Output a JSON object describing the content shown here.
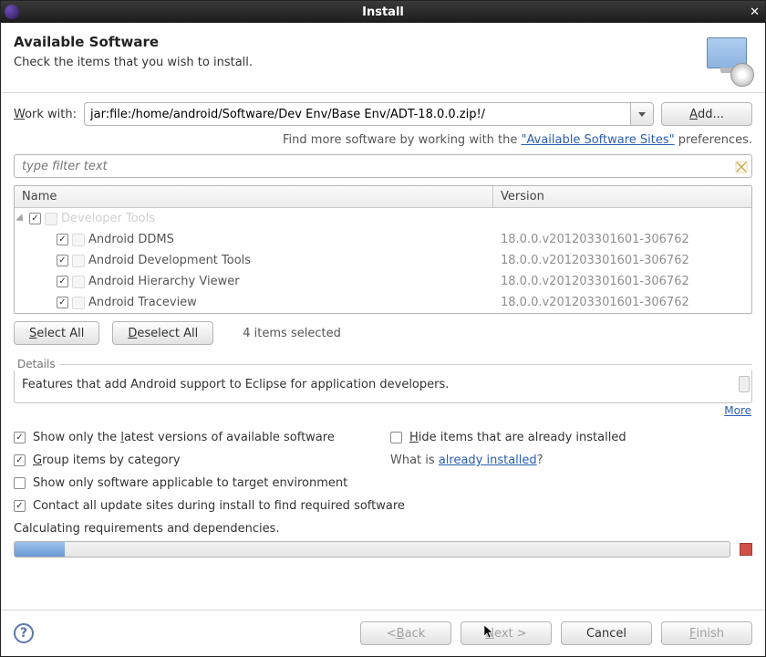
{
  "window": {
    "title": "Install"
  },
  "header": {
    "title": "Available Software",
    "subtitle": "Check the items that you wish to install."
  },
  "workwith": {
    "label_pre": "W",
    "label_post": "ork with:",
    "value": "jar:file:/home/android/Software/Dev Env/Base Env/ADT-18.0.0.zip!/",
    "add_pre": "A",
    "add_post": "dd..."
  },
  "findmore": {
    "prefix": "Find more software by working with the ",
    "link": "\"Available Software Sites\"",
    "suffix": " preferences."
  },
  "filter": {
    "placeholder": "type filter text"
  },
  "columns": {
    "name": "Name",
    "version": "Version"
  },
  "group": {
    "label": "Developer Tools",
    "checked": true
  },
  "items": [
    {
      "name": "Android DDMS",
      "version": "18.0.0.v201203301601-306762",
      "checked": true
    },
    {
      "name": "Android Development Tools",
      "version": "18.0.0.v201203301601-306762",
      "checked": true
    },
    {
      "name": "Android Hierarchy Viewer",
      "version": "18.0.0.v201203301601-306762",
      "checked": true
    },
    {
      "name": "Android Traceview",
      "version": "18.0.0.v201203301601-306762",
      "checked": true
    }
  ],
  "selection": {
    "select_all_pre": "S",
    "select_all_post": "elect All",
    "deselect_all_pre": "D",
    "deselect_all_post": "eselect All",
    "count_text": "4 items selected"
  },
  "details": {
    "legend": "Details",
    "text": "Features that add Android support to Eclipse for application developers.",
    "more": "More"
  },
  "options": {
    "latest_pre": "Show only the ",
    "latest_ul": "l",
    "latest_post": "atest versions of available software",
    "hide_pre": "H",
    "hide_post": "ide items that are already installed",
    "group_pre": "G",
    "group_post": "roup items by category",
    "already_q_pre": "What is ",
    "already_q_link": "already installed",
    "already_q_post": "?",
    "applicable": "Show only software applicable to target environment",
    "contact_pre": "Contact all update sites during install to find required software",
    "latest_checked": true,
    "hide_checked": false,
    "group_checked": true,
    "applicable_checked": false,
    "contact_checked": true
  },
  "status": {
    "text": "Calculating requirements and dependencies."
  },
  "footer": {
    "back_pre": "< ",
    "back_ul": "B",
    "back_post": "ack",
    "next_pre": "N",
    "next_post": "ext >",
    "cancel": "Cancel",
    "finish_pre": "F",
    "finish_post": "inish"
  }
}
